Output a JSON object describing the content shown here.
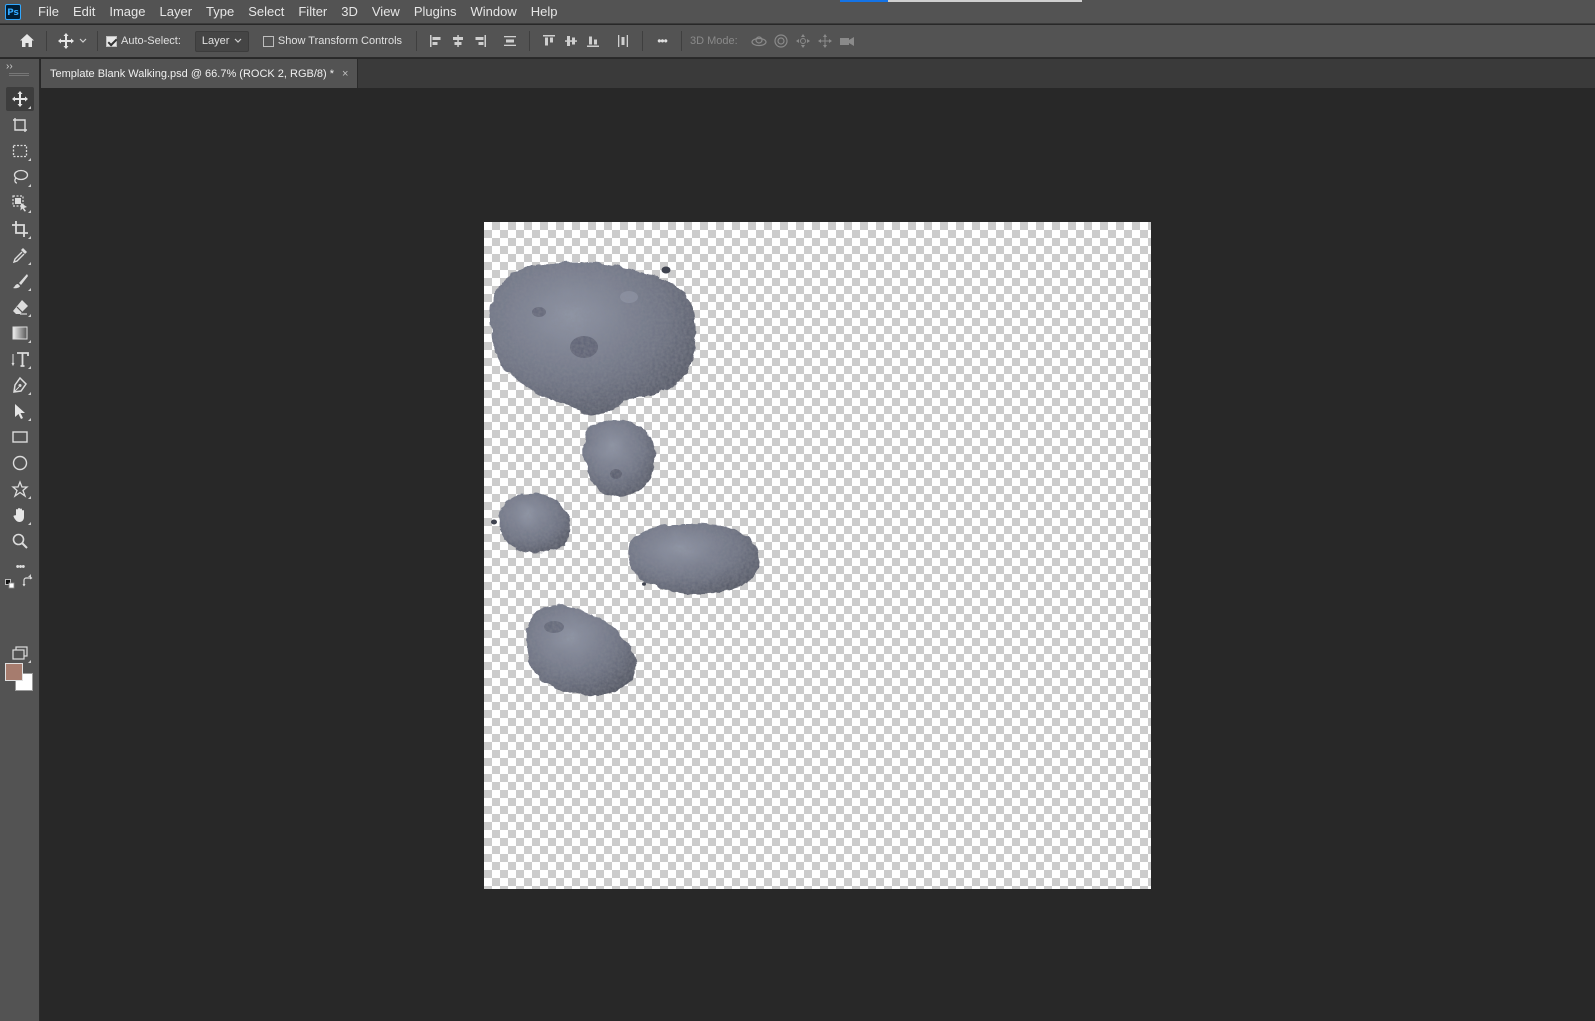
{
  "app": {
    "logo_text": "Ps"
  },
  "menu": {
    "items": [
      "File",
      "Edit",
      "Image",
      "Layer",
      "Type",
      "Select",
      "Filter",
      "3D",
      "View",
      "Plugins",
      "Window",
      "Help"
    ]
  },
  "options": {
    "auto_select_label": "Auto-Select:",
    "auto_select_checked": true,
    "layer_dropdown_value": "Layer",
    "show_transform_label": "Show Transform Controls",
    "show_transform_checked": false,
    "more_label": "•••",
    "mode_3d_label": "3D Mode:"
  },
  "document": {
    "tab_title": "Template Blank Walking.psd @ 66.7% (ROCK 2, RGB/8) *",
    "close_glyph": "×"
  },
  "tools": {
    "collapse_glyph": "››",
    "more_tools_glyph": "•••"
  },
  "colors": {
    "foreground": "#a67c6e",
    "background": "#ffffff",
    "accent": "#1473e6",
    "rock": "#74798a"
  }
}
